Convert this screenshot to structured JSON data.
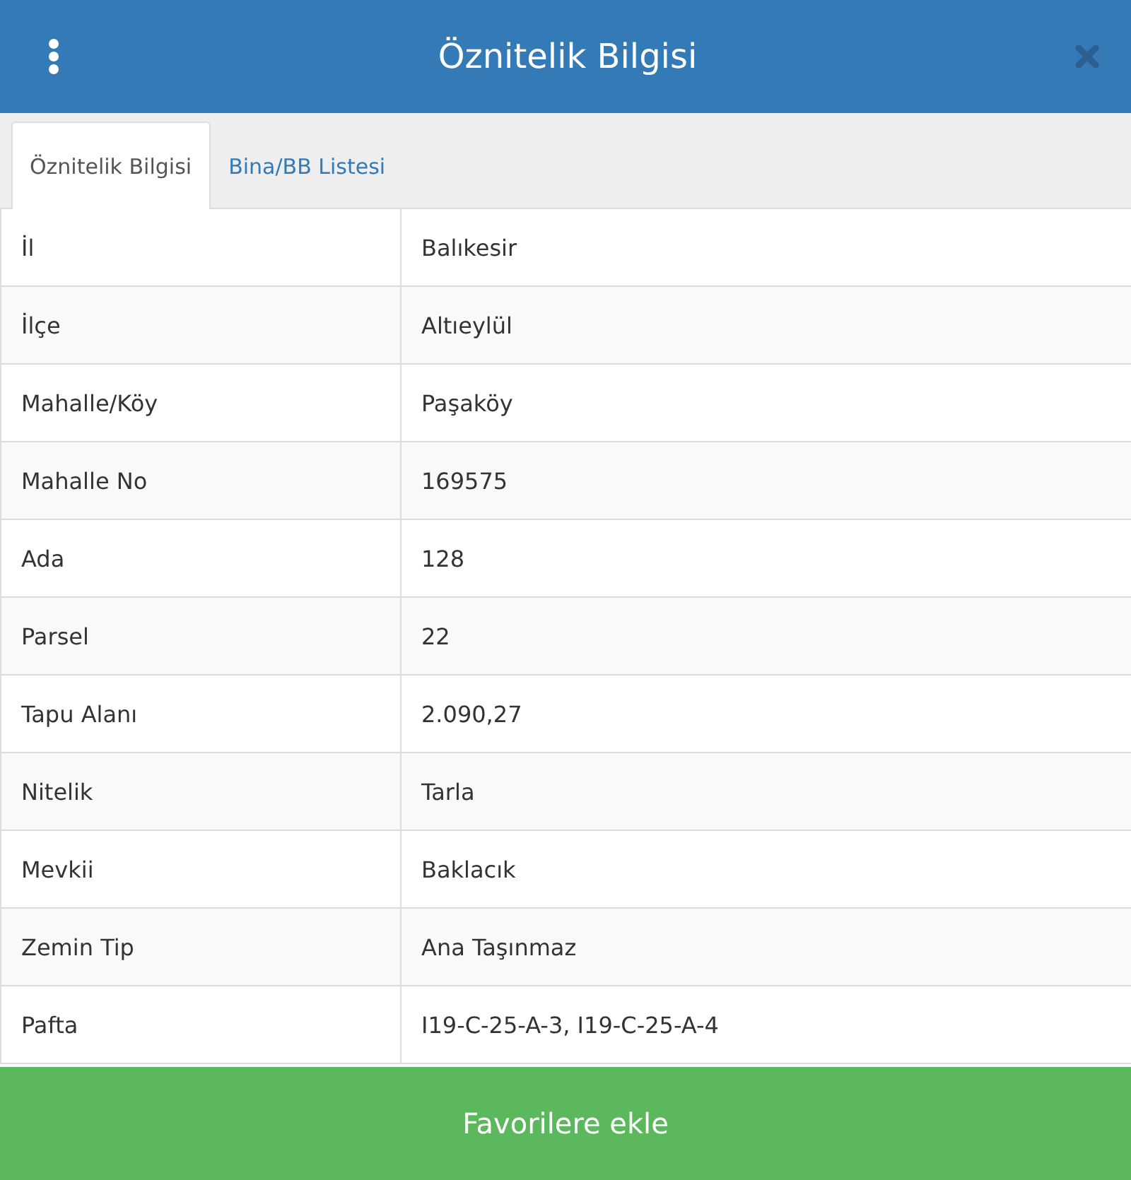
{
  "header": {
    "title": "Öznitelik Bilgisi"
  },
  "tabs": [
    {
      "label": "Öznitelik Bilgisi",
      "selected": true
    },
    {
      "label": "Bina/BB Listesi",
      "selected": false
    }
  ],
  "rows": [
    {
      "label": "İl",
      "value": "Balıkesir"
    },
    {
      "label": "İlçe",
      "value": "Altıeylül"
    },
    {
      "label": "Mahalle/Köy",
      "value": "Paşaköy"
    },
    {
      "label": "Mahalle No",
      "value": "169575"
    },
    {
      "label": "Ada",
      "value": "128"
    },
    {
      "label": "Parsel",
      "value": "22"
    },
    {
      "label": "Tapu Alanı",
      "value": "2.090,27"
    },
    {
      "label": "Nitelik",
      "value": "Tarla"
    },
    {
      "label": "Mevkii",
      "value": "Baklacık"
    },
    {
      "label": "Zemin Tip",
      "value": "Ana Taşınmaz"
    },
    {
      "label": "Pafta",
      "value": "I19-C-25-A-3, I19-C-25-A-4"
    }
  ],
  "button": "Favorilere ekle"
}
